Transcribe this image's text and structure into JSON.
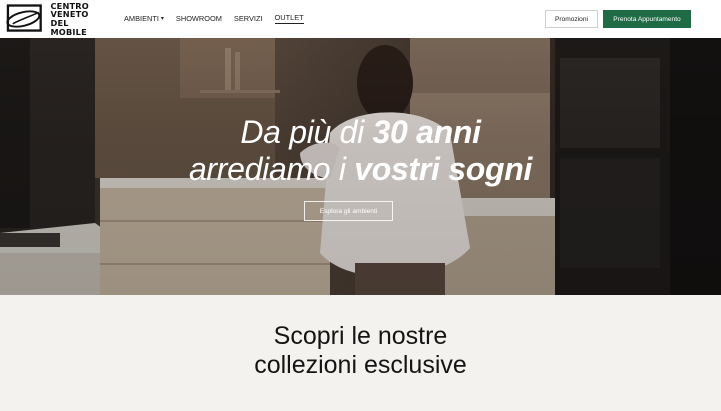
{
  "header": {
    "logo_lines": [
      "CENTRO",
      "VENETO",
      "DEL MOBILE"
    ],
    "nav": [
      {
        "label": "AMBIENTI",
        "has_dropdown": true,
        "icon": "chevron-down-icon"
      },
      {
        "label": "SHOWROOM",
        "has_dropdown": false
      },
      {
        "label": "SERVIZI",
        "has_dropdown": false
      },
      {
        "label": "OUTLET",
        "has_dropdown": false,
        "active": true
      }
    ],
    "promo_button": "Promozioni",
    "appointment_button": "Prenota Appuntamento"
  },
  "hero": {
    "title_line1_a": "Da più di ",
    "title_line1_b": "30 anni",
    "title_line2_a": "arrediamo i ",
    "title_line2_b": "vostri sogni",
    "cta": "Esplora gli ambienti"
  },
  "collections": {
    "title_line1": "Scopri le nostre",
    "title_line2": "collezioni esclusive"
  },
  "colors": {
    "accent_green": "#1f6b45",
    "page_background": "#f4f2ee"
  }
}
